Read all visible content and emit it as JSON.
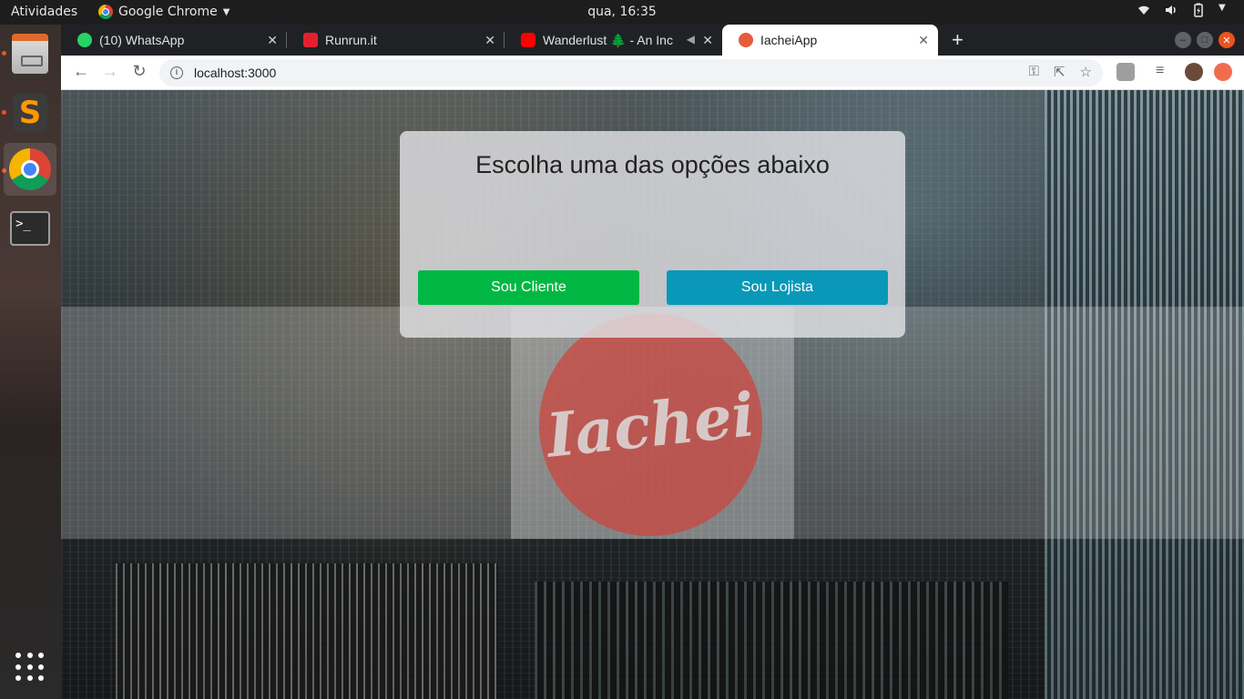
{
  "os": {
    "activities": "Atividades",
    "app_menu": "Google Chrome",
    "clock": "qua, 16:35"
  },
  "browser": {
    "tabs": [
      {
        "title": "(10) WhatsApp",
        "favicon_color": "#25d366"
      },
      {
        "title": "Runrun.it",
        "favicon_color": "#e5202e"
      },
      {
        "title": "Wanderlust 🌲 - An Inc",
        "favicon_color": "#ff0000"
      },
      {
        "title": "IacheiApp",
        "favicon_color": "#e75a3c"
      }
    ],
    "url": "localhost:3000"
  },
  "page": {
    "heading": "Escolha uma das opções abaixo",
    "buttons": {
      "cliente": "Sou Cliente",
      "lojista": "Sou Lojista"
    },
    "logo_text": "Iachei",
    "colors": {
      "cliente": "#00b843",
      "lojista": "#0a98b8",
      "logo": "#ce423c"
    }
  }
}
